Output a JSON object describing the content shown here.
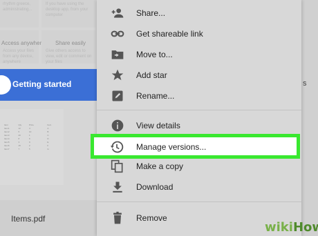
{
  "background": {
    "tiles": [
      {
        "text": "rhythm greece, administrating..."
      },
      {
        "text": "If you have using the desktop app, from your computer"
      },
      {
        "heading": "Access anywhere",
        "text": "Access your files from any device, anywhere"
      },
      {
        "heading": "Share easily",
        "text": "Give others access to view, edit or comment on your files"
      }
    ],
    "getting_started": "Getting started",
    "right_fragment": "s",
    "file_name": "Items.pdf"
  },
  "menu": {
    "items": [
      {
        "label": "Share...",
        "icon": "share-person-icon"
      },
      {
        "label": "Get shareable link",
        "icon": "link-icon"
      },
      {
        "label": "Move to...",
        "icon": "move-folder-icon"
      },
      {
        "label": "Add star",
        "icon": "star-icon"
      },
      {
        "label": "Rename...",
        "icon": "pencil-icon"
      },
      {
        "label": "View details",
        "icon": "info-icon"
      },
      {
        "label": "Manage versions...",
        "icon": "history-icon"
      },
      {
        "label": "Make a copy",
        "icon": "copy-icon"
      },
      {
        "label": "Download",
        "icon": "download-icon"
      },
      {
        "label": "Remove",
        "icon": "trash-icon"
      }
    ]
  },
  "colors": {
    "highlight_border": "#39e82f",
    "getting_started_bg": "#3b6fd6",
    "icon": "#555555"
  },
  "watermark": {
    "part1": "wiki",
    "part2": "How"
  }
}
